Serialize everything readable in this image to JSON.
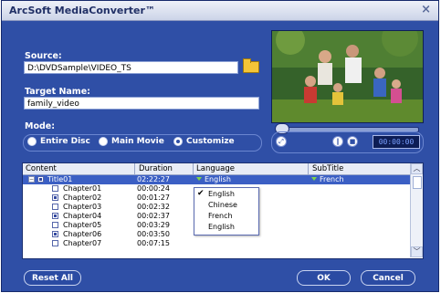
{
  "window": {
    "title": "ArcSoft MediaConverter™",
    "close_glyph": "×"
  },
  "source": {
    "label": "Source:",
    "value": "D:\\DVDSample\\VIDEO_TS"
  },
  "target": {
    "label": "Target Name:",
    "value": "family_video"
  },
  "mode": {
    "label": "Mode:",
    "options": [
      "Entire Disc",
      "Main Movie",
      "Customize"
    ],
    "selected": "Customize"
  },
  "player": {
    "time": "00:00:00",
    "progress": 0
  },
  "table": {
    "headers": [
      "Content",
      "Duration",
      "Language",
      "SubTitle"
    ],
    "rows": [
      {
        "name": "Title01",
        "duration": "02:22:27",
        "language": "English",
        "subtitle": "French",
        "checked": true,
        "selected": true
      },
      {
        "name": "Chapter01",
        "duration": "00:00:24",
        "checked": false
      },
      {
        "name": "Chapter02",
        "duration": "00:01:27",
        "checked": true
      },
      {
        "name": "Chapter03",
        "duration": "00:02:32",
        "checked": false
      },
      {
        "name": "Chapter04",
        "duration": "00:02:37",
        "checked": true
      },
      {
        "name": "Chapter05",
        "duration": "00:03:29",
        "checked": false
      },
      {
        "name": "Chapter06",
        "duration": "00:03:50",
        "checked": true
      },
      {
        "name": "Chapter07",
        "duration": "00:07:15",
        "checked": false
      }
    ]
  },
  "language_menu": {
    "items": [
      "English",
      "Chinese",
      "French",
      "English"
    ],
    "checked_index": 0
  },
  "buttons": {
    "reset": "Reset All",
    "ok": "OK",
    "cancel": "Cancel"
  },
  "colors": {
    "window_bg": "#2f4fa6",
    "selection": "#3b5fc4",
    "accent_green": "#7fd34a"
  }
}
